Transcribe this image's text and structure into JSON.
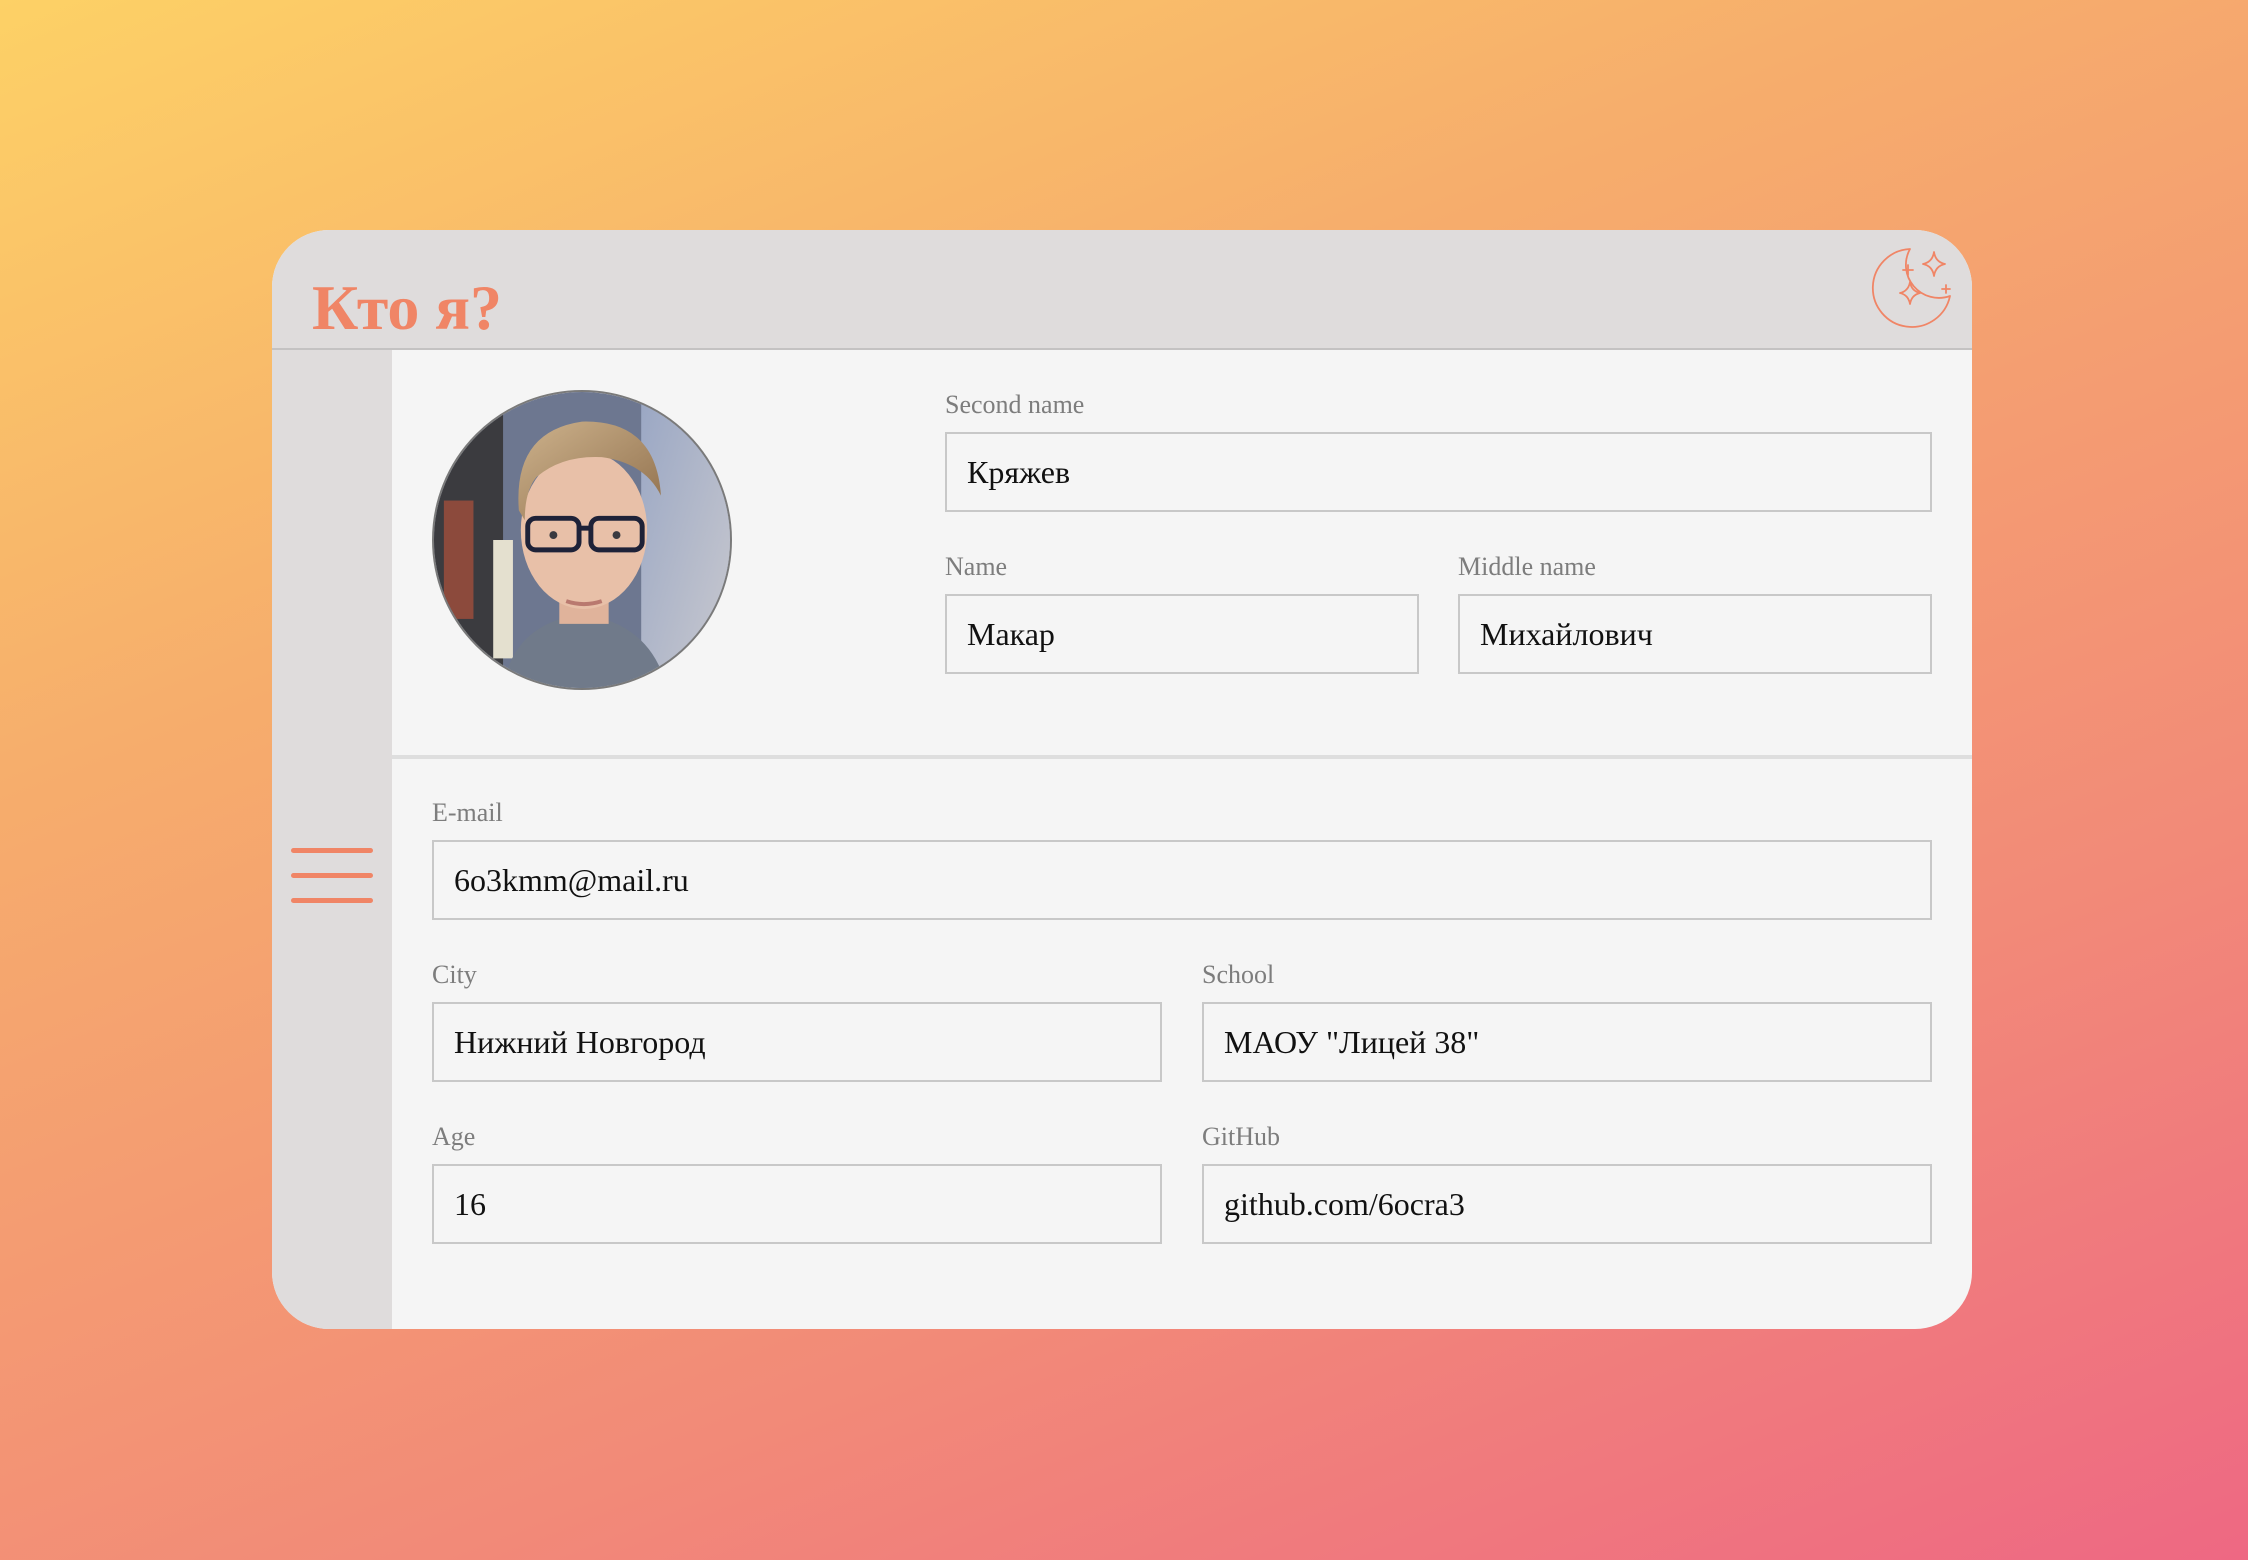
{
  "header": {
    "title": "Кто я?",
    "theme_icon": "moon-stars-icon"
  },
  "sidebar": {
    "menu_icon": "hamburger-menu-icon"
  },
  "colors": {
    "accent": "#f08566",
    "panel_gray": "#dfdcdc",
    "surface": "#f5f5f5",
    "label_gray": "#7d7d7d"
  },
  "profile": {
    "avatar": "profile-photo",
    "fields": {
      "second_name": {
        "label": "Second name",
        "value": "Кряжев"
      },
      "name": {
        "label": "Name",
        "value": "Макар"
      },
      "middle_name": {
        "label": "Middle name",
        "value": "Михайлович"
      },
      "email": {
        "label": "E-mail",
        "value": "6o3kmm@mail.ru"
      },
      "city": {
        "label": "City",
        "value": "Нижний Новгород"
      },
      "school": {
        "label": "School",
        "value": "МАОУ \"Лицей 38\""
      },
      "age": {
        "label": "Age",
        "value": "16"
      },
      "github": {
        "label": "GitHub",
        "value": "github.com/6ocra3"
      }
    }
  }
}
